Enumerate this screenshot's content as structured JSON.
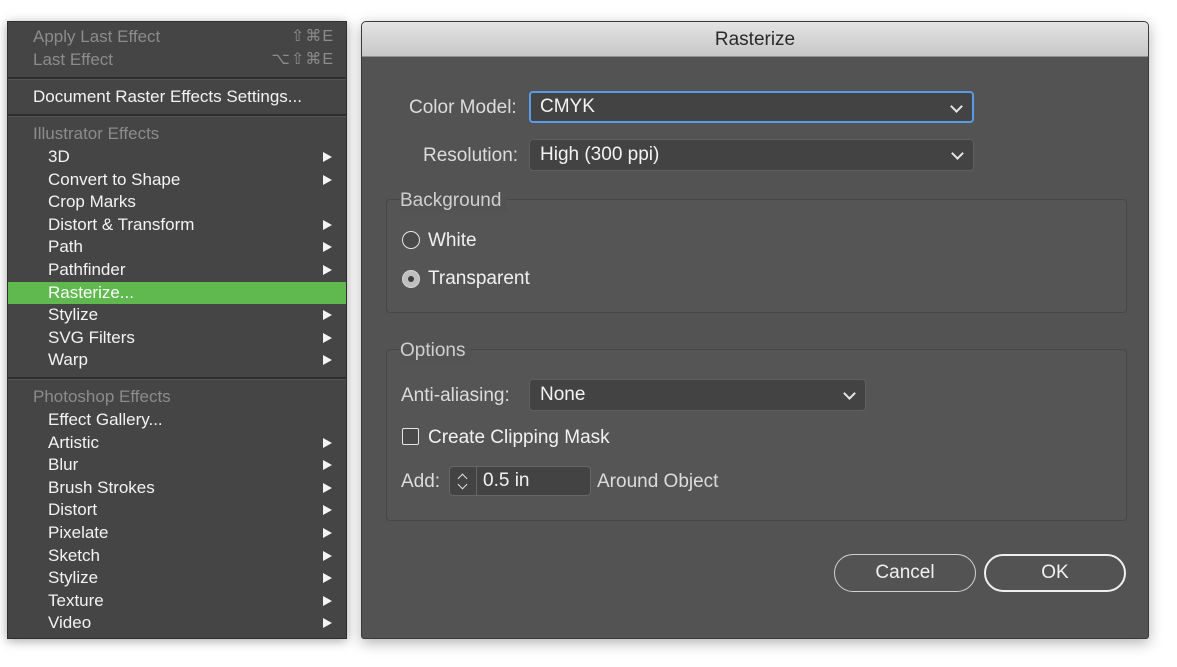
{
  "menu": {
    "apply_last": {
      "label": "Apply Last Effect",
      "shortcut": "⇧⌘E"
    },
    "last": {
      "label": "Last Effect",
      "shortcut": "⌥⇧⌘E"
    },
    "doc_settings": "Document Raster Effects Settings...",
    "illustrator_header": "Illustrator Effects",
    "illustrator_items": [
      {
        "label": "3D",
        "submenu": true
      },
      {
        "label": "Convert to Shape",
        "submenu": true
      },
      {
        "label": "Crop Marks",
        "submenu": false
      },
      {
        "label": "Distort & Transform",
        "submenu": true
      },
      {
        "label": "Path",
        "submenu": true
      },
      {
        "label": "Pathfinder",
        "submenu": true
      },
      {
        "label": "Rasterize...",
        "submenu": false,
        "highlighted": true
      },
      {
        "label": "Stylize",
        "submenu": true
      },
      {
        "label": "SVG Filters",
        "submenu": true
      },
      {
        "label": "Warp",
        "submenu": true
      }
    ],
    "photoshop_header": "Photoshop Effects",
    "photoshop_items": [
      {
        "label": "Effect Gallery...",
        "submenu": false
      },
      {
        "label": "Artistic",
        "submenu": true
      },
      {
        "label": "Blur",
        "submenu": true
      },
      {
        "label": "Brush Strokes",
        "submenu": true
      },
      {
        "label": "Distort",
        "submenu": true
      },
      {
        "label": "Pixelate",
        "submenu": true
      },
      {
        "label": "Sketch",
        "submenu": true
      },
      {
        "label": "Stylize",
        "submenu": true
      },
      {
        "label": "Texture",
        "submenu": true
      },
      {
        "label": "Video",
        "submenu": true
      }
    ],
    "highlight_color": "#5fb94f"
  },
  "dialog": {
    "title": "Rasterize",
    "color_model": {
      "label": "Color Model:",
      "value": "CMYK"
    },
    "resolution": {
      "label": "Resolution:",
      "value": "High (300 ppi)"
    },
    "background": {
      "title": "Background",
      "options": [
        {
          "label": "White",
          "checked": false
        },
        {
          "label": "Transparent",
          "checked": true
        }
      ]
    },
    "options": {
      "title": "Options",
      "anti_aliasing": {
        "label": "Anti-aliasing:",
        "value": "None"
      },
      "clipping_mask": {
        "label": "Create Clipping Mask",
        "checked": false
      },
      "add": {
        "label": "Add:",
        "value": "0.5 in",
        "suffix": "Around Object"
      }
    },
    "buttons": {
      "cancel": "Cancel",
      "ok": "OK"
    },
    "focus_color": "#5b9ae6"
  }
}
